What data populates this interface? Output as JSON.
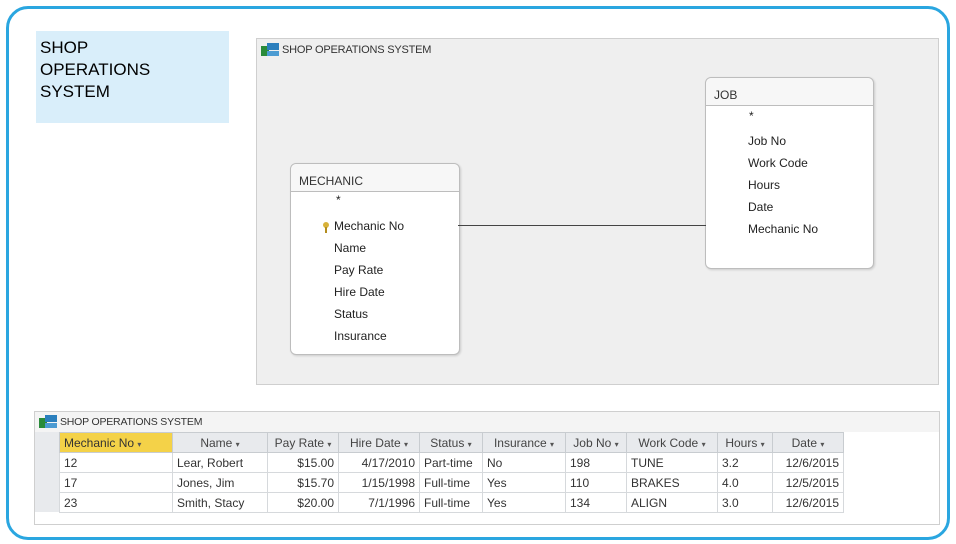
{
  "caption": "SHOP\nOPERATIONS\nSYSTEM",
  "relationships_window": {
    "title": "SHOP OPERATIONS SYSTEM",
    "mechanic_table": {
      "name": "MECHANIC",
      "star": "*",
      "fields": [
        "Mechanic No",
        "Name",
        "Pay Rate",
        "Hire Date",
        "Status",
        "Insurance"
      ]
    },
    "job_table": {
      "name": "JOB",
      "star": "*",
      "fields": [
        "Job No",
        "Work Code",
        "Hours",
        "Date",
        "Mechanic No"
      ]
    }
  },
  "datasheet": {
    "title": "SHOP OPERATIONS SYSTEM",
    "columns": [
      "Mechanic No",
      "Name",
      "Pay Rate",
      "Hire Date",
      "Status",
      "Insurance",
      "Job No",
      "Work Code",
      "Hours",
      "Date"
    ],
    "rows": [
      [
        "12",
        "Lear, Robert",
        "$15.00",
        "4/17/2010",
        "Part-time",
        "No",
        "198",
        "TUNE",
        "3.2",
        "12/6/2015"
      ],
      [
        "17",
        "Jones, Jim",
        "$15.70",
        "1/15/1998",
        "Full-time",
        "Yes",
        "110",
        "BRAKES",
        "4.0",
        "12/5/2015"
      ],
      [
        "23",
        "Smith, Stacy",
        "$20.00",
        "7/1/1996",
        "Full-time",
        "Yes",
        "134",
        "ALIGN",
        "3.0",
        "12/6/2015"
      ]
    ]
  },
  "colors": {
    "frame": "#2aa6e0",
    "caption_bg": "#d9eefa",
    "selected_header": "#f4d248"
  }
}
